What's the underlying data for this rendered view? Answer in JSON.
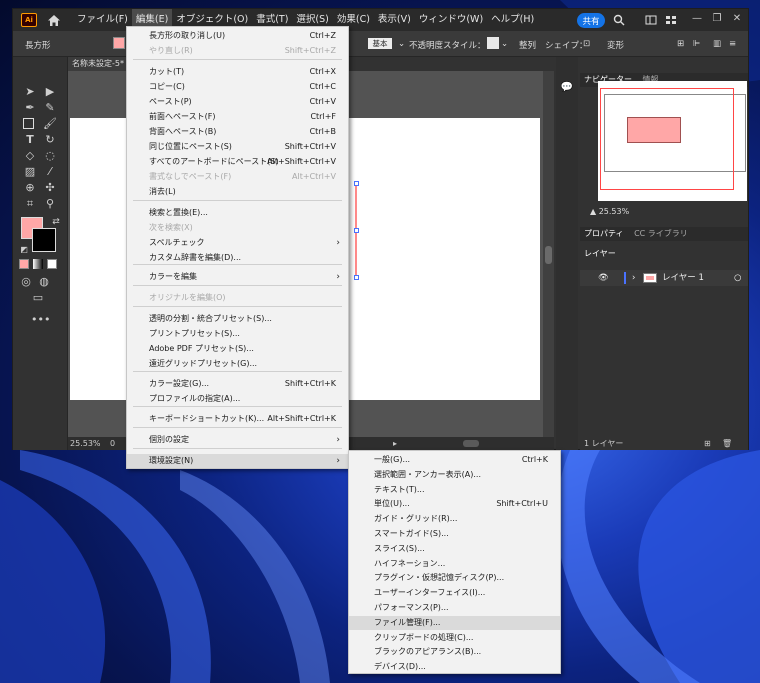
{
  "app": {
    "logo": "Ai",
    "menus": [
      "ファイル(F)",
      "編集(E)",
      "オブジェクト(O)",
      "書式(T)",
      "選択(S)",
      "効果(C)",
      "表示(V)",
      "ウィンドウ(W)",
      "ヘルプ(H)"
    ],
    "active_menu": "編集(E)",
    "share_label": "共有",
    "window_controls": [
      "—",
      "❐",
      "✕"
    ]
  },
  "controlbar": {
    "selection_label": "長方形",
    "stroke_style": "基本",
    "opacity_label": "不透明度",
    "style_label": "スタイル：",
    "align_label": "整列",
    "shape_label": "シェイプ：",
    "transform_label": "変形"
  },
  "document": {
    "tab_title": "名称未設定-5*",
    "zoom": "25.53%",
    "zoom_secondary": "0"
  },
  "colors": {
    "fill": "#ffa7a7",
    "stroke": "#000000",
    "accent": "#1473e6"
  },
  "panels": {
    "navigator_tabs": [
      "ナビゲーター",
      "情報"
    ],
    "navigator_zoom": "25.53%",
    "property_tabs": [
      "プロパティ",
      "CC ライブラリ"
    ],
    "layers_title": "レイヤー",
    "layer_name": "レイヤー 1",
    "layer_count": "1 レイヤー"
  },
  "edit_menu": {
    "items": [
      {
        "label": "長方形の取り消し(U)",
        "shortcut": "Ctrl+Z",
        "disabled": false
      },
      {
        "label": "やり直し(R)",
        "shortcut": "Shift+Ctrl+Z",
        "disabled": true
      },
      {
        "label": "カット(T)",
        "shortcut": "Ctrl+X",
        "disabled": false
      },
      {
        "label": "コピー(C)",
        "shortcut": "Ctrl+C",
        "disabled": false
      },
      {
        "label": "ペースト(P)",
        "shortcut": "Ctrl+V",
        "disabled": false
      },
      {
        "label": "前面へペースト(F)",
        "shortcut": "Ctrl+F",
        "disabled": false
      },
      {
        "label": "背面へペースト(B)",
        "shortcut": "Ctrl+B",
        "disabled": false
      },
      {
        "label": "同じ位置にペースト(S)",
        "shortcut": "Shift+Ctrl+V",
        "disabled": false
      },
      {
        "label": "すべてのアートボードにペースト(S)",
        "shortcut": "Alt+Shift+Ctrl+V",
        "disabled": false
      },
      {
        "label": "書式なしでペースト(F)",
        "shortcut": "Alt+Ctrl+V",
        "disabled": true
      },
      {
        "label": "消去(L)",
        "shortcut": "",
        "disabled": false
      },
      {
        "label": "検索と置換(E)...",
        "shortcut": "",
        "disabled": false
      },
      {
        "label": "次を検索(X)",
        "shortcut": "",
        "disabled": true
      },
      {
        "label": "スペルチェック",
        "shortcut": "",
        "disabled": false,
        "submenu": true
      },
      {
        "label": "カスタム辞書を編集(D)...",
        "shortcut": "",
        "disabled": false
      },
      {
        "label": "カラーを編集",
        "shortcut": "",
        "disabled": false,
        "submenu": true
      },
      {
        "label": "オリジナルを編集(O)",
        "shortcut": "",
        "disabled": true
      },
      {
        "label": "透明の分割・統合プリセット(S)...",
        "shortcut": "",
        "disabled": false
      },
      {
        "label": "プリントプリセット(S)...",
        "shortcut": "",
        "disabled": false
      },
      {
        "label": "Adobe PDF プリセット(S)...",
        "shortcut": "",
        "disabled": false
      },
      {
        "label": "遠近グリッドプリセット(G)...",
        "shortcut": "",
        "disabled": false
      },
      {
        "label": "カラー設定(G)...",
        "shortcut": "Shift+Ctrl+K",
        "disabled": false
      },
      {
        "label": "プロファイルの指定(A)...",
        "shortcut": "",
        "disabled": false
      },
      {
        "label": "キーボードショートカット(K)...",
        "shortcut": "Alt+Shift+Ctrl+K",
        "disabled": false
      },
      {
        "label": "個別の設定",
        "shortcut": "",
        "disabled": false,
        "submenu": true
      },
      {
        "label": "環境設定(N)",
        "shortcut": "",
        "disabled": false,
        "submenu": true,
        "highlighted": true
      }
    ]
  },
  "preferences_menu": {
    "items": [
      {
        "label": "一般(G)...",
        "shortcut": "Ctrl+K"
      },
      {
        "label": "選択範囲・アンカー表示(A)...",
        "shortcut": ""
      },
      {
        "label": "テキスト(T)...",
        "shortcut": ""
      },
      {
        "label": "単位(U)...",
        "shortcut": "Shift+Ctrl+U"
      },
      {
        "label": "ガイド・グリッド(R)...",
        "shortcut": ""
      },
      {
        "label": "スマートガイド(S)...",
        "shortcut": ""
      },
      {
        "label": "スライス(S)...",
        "shortcut": ""
      },
      {
        "label": "ハイフネーション...",
        "shortcut": ""
      },
      {
        "label": "プラグイン・仮想記憶ディスク(P)...",
        "shortcut": ""
      },
      {
        "label": "ユーザーインターフェイス(I)...",
        "shortcut": ""
      },
      {
        "label": "パフォーマンス(P)...",
        "shortcut": ""
      },
      {
        "label": "ファイル管理(F)...",
        "shortcut": "",
        "highlighted": true
      },
      {
        "label": "クリップボードの処理(C)...",
        "shortcut": ""
      },
      {
        "label": "ブラックのアピアランス(B)...",
        "shortcut": ""
      },
      {
        "label": "デバイス(D)...",
        "shortcut": ""
      }
    ]
  }
}
